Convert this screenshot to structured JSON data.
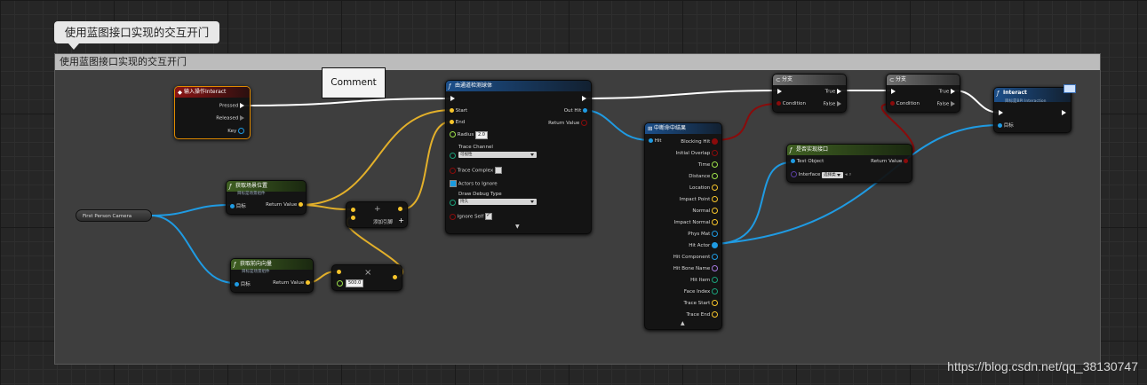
{
  "graph": {
    "bubble_text": "使用蓝图接口实现的交互开门",
    "comment_box_title": "使用蓝图接口实现的交互开门",
    "comment_node": "Comment",
    "watermark": "https://blog.csdn.net/qq_38130747"
  },
  "nodes": {
    "input_action": {
      "title": "输入操作Interact",
      "pressed": "Pressed",
      "released": "Released",
      "key": "Key"
    },
    "camera": {
      "label": "First Person Camera"
    },
    "get_location": {
      "title": "获取场景位置",
      "subtitle": "目标是场景组件",
      "target": "目标",
      "return": "Return Value"
    },
    "get_forward": {
      "title": "获取前向向量",
      "subtitle": "目标是场景组件",
      "target": "目标",
      "return": "Return Value"
    },
    "add": {
      "label": "添加引脚",
      "plus": "+"
    },
    "multiply": {
      "value": "500.0",
      "symbol": "×"
    },
    "sphere_trace": {
      "title": "由通道检测球体",
      "start": "Start",
      "end": "End",
      "radius": "Radius",
      "radius_value": "2.0",
      "trace_channel": "Trace Channel",
      "trace_channel_value": "可视性",
      "trace_complex": "Trace Complex",
      "actors_to_ignore": "Actors to Ignore",
      "draw_debug": "Draw Debug Type",
      "draw_debug_value": "持久",
      "ignore_self": "Ignore Self",
      "out_hit": "Out Hit",
      "return": "Return Value"
    },
    "break_hit": {
      "title": "中断命中结果",
      "hit": "Hit",
      "outputs": [
        "Blocking Hit",
        "Initial Overlap",
        "Time",
        "Distance",
        "Location",
        "Impact Point",
        "Normal",
        "Impact Normal",
        "Phys Mat",
        "Hit Actor",
        "Hit Component",
        "Hit Bone Name",
        "Hit Item",
        "Face Index",
        "Trace Start",
        "Trace End"
      ]
    },
    "branch1": {
      "title": "分支",
      "condition": "Condition",
      "true": "True",
      "false": "False"
    },
    "branch2": {
      "title": "分支",
      "condition": "Condition",
      "true": "True",
      "false": "False"
    },
    "implements": {
      "title": "是否实现接口",
      "test_object": "Test Object",
      "interface": "Interface",
      "interface_value": "选择类",
      "return": "Return Value"
    },
    "interact": {
      "title": "Interact",
      "subtitle": "目标是BPI Interaction",
      "target": "目标"
    }
  },
  "colors": {
    "exec": "#ffffff",
    "vector": "#f7c52b",
    "object": "#1f9be3",
    "bool": "#8a0b0b",
    "float": "#9ee24a",
    "struct": "#0a6fc2"
  }
}
